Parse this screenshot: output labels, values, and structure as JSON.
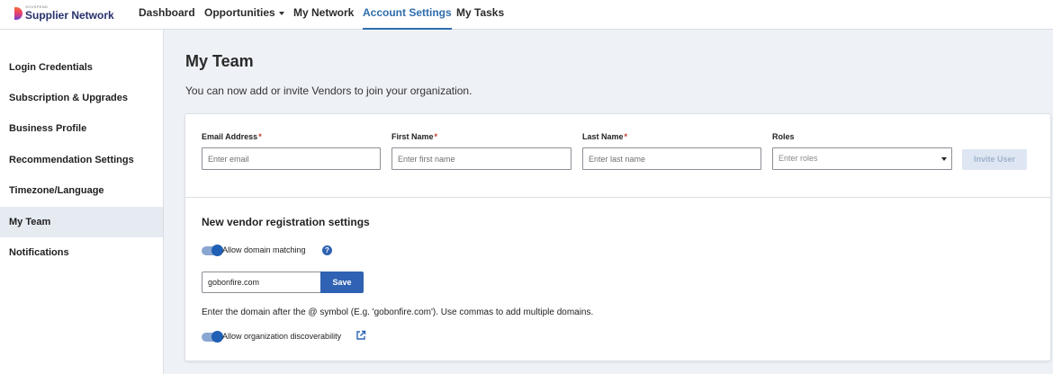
{
  "brand": {
    "small_text": "GOVSPEND",
    "name": "Supplier Network"
  },
  "nav": {
    "items": [
      {
        "label": "Dashboard"
      },
      {
        "label": "Opportunities"
      },
      {
        "label": "My Network"
      },
      {
        "label": "Account Settings"
      },
      {
        "label": "My Tasks"
      }
    ],
    "active": "Account Settings"
  },
  "sidebar": {
    "items": [
      {
        "label": "Login Credentials"
      },
      {
        "label": "Subscription & Upgrades"
      },
      {
        "label": "Business Profile"
      },
      {
        "label": "Recommendation Settings"
      },
      {
        "label": "Timezone/Language"
      },
      {
        "label": "My Team"
      },
      {
        "label": "Notifications"
      }
    ],
    "active": "My Team"
  },
  "page": {
    "title": "My Team",
    "subtitle": "You can now add or invite Vendors to join your organization."
  },
  "invite_form": {
    "email": {
      "label": "Email Address",
      "required_mark": "*",
      "placeholder": "Enter email",
      "value": ""
    },
    "first_name": {
      "label": "First Name",
      "required_mark": "*",
      "placeholder": "Enter first name",
      "value": ""
    },
    "last_name": {
      "label": "Last Name",
      "required_mark": "*",
      "placeholder": "Enter last name",
      "value": ""
    },
    "roles": {
      "label": "Roles",
      "placeholder": "Enter roles"
    },
    "invite_button": "Invite User"
  },
  "registration": {
    "title": "New vendor registration settings",
    "domain_matching": {
      "label": "Allow domain matching",
      "enabled": true,
      "help_glyph": "?"
    },
    "domain_input": {
      "value": "gobonfire.com"
    },
    "save_button": "Save",
    "help_text": "Enter the domain after the @ symbol (E.g. 'gobonfire.com'). Use commas to add multiple domains.",
    "discoverability": {
      "label": "Allow organization discoverability",
      "enabled": true
    }
  },
  "icons": {
    "help": "help-icon",
    "external_link": "external-link-icon",
    "dropdown": "chevron-down-icon"
  },
  "colors": {
    "accent": "#2e6dad",
    "primary_button": "#2f62b3",
    "disabled_button_bg": "#dde6f2",
    "toggle_on": "#1f5fb4",
    "page_bg": "#eef1f6"
  }
}
